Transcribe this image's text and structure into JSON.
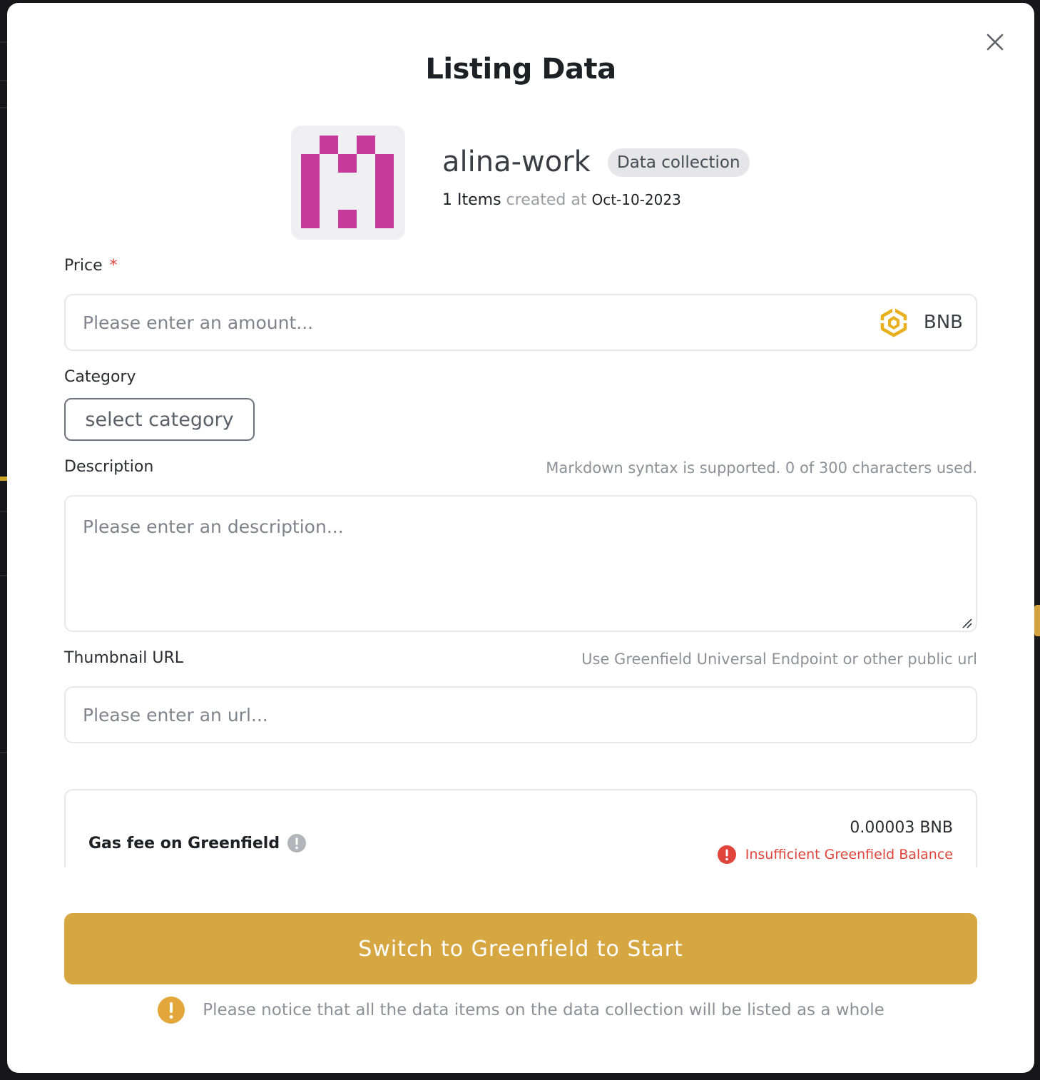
{
  "modal": {
    "title": "Listing Data",
    "close_icon": "close-icon"
  },
  "collection": {
    "name": "alina-work",
    "badge": "Data collection",
    "items_count": "1 Items",
    "created_label": "created at",
    "created_date": "Oct-10-2023",
    "thumbnail_color": "#c63a9b"
  },
  "price": {
    "label": "Price",
    "required_mark": "*",
    "placeholder": "Please enter an amount...",
    "currency": "BNB",
    "currency_icon": "bnb-icon"
  },
  "category": {
    "label": "Category",
    "button_label": "select category"
  },
  "description": {
    "label": "Description",
    "hint": "Markdown syntax is supported. 0 of 300 characters used.",
    "placeholder": "Please enter an description..."
  },
  "thumbnail_url": {
    "label": "Thumbnail URL",
    "hint": "Use Greenfield Universal Endpoint or other public url",
    "placeholder": "Please enter an url..."
  },
  "gas": {
    "label": "Gas fee on Greenfield",
    "value": "0.00003 BNB",
    "error": "Insufficient Greenfield Balance",
    "error_color": "#e0453b"
  },
  "cta": {
    "label": "Switch to Greenfield to Start",
    "color": "#d6a641"
  },
  "notice": {
    "text": "Please notice that all the data items on the data collection will be listed as a whole",
    "icon": "warning-icon"
  }
}
